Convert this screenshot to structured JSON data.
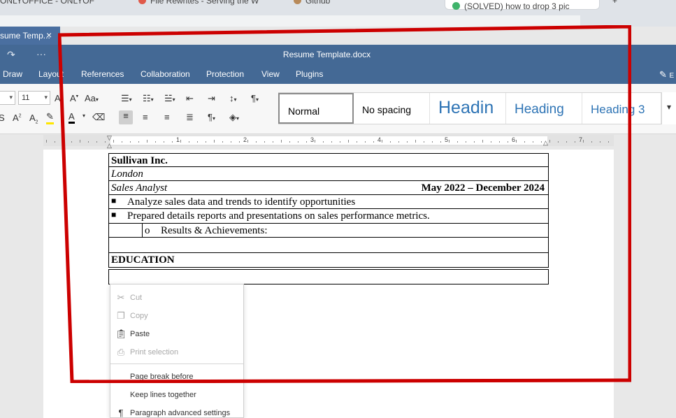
{
  "browser": {
    "tabs": [
      {
        "label": "ONLYOFFICE - ONLYOF",
        "dot": "#e08a33"
      },
      {
        "label": "File Rewrites - Serving the W",
        "dot": "#e05a4a"
      },
      {
        "label": "Github",
        "dot": "#b88a5a"
      },
      {
        "label": "(SOLVED) how to drop 3 pic",
        "dot": "#3fb36b"
      }
    ],
    "new_tab": "+"
  },
  "editor": {
    "doc_tab": "sume Temp...",
    "doc_tab_close": "×",
    "title": "Resume Template.docx",
    "redo_icon": "↷",
    "more_icon": "···",
    "menu": [
      "Draw",
      "Layout",
      "References",
      "Collaboration",
      "Protection",
      "View",
      "Plugins"
    ],
    "edit_label": "E"
  },
  "toolbar": {
    "font_name": "",
    "font_size": "11",
    "styles": [
      "Normal",
      "No spacing",
      "Headin",
      "Heading",
      "Heading 3"
    ],
    "style_colors": {
      "normal": "#000000",
      "heading": "#2e74b5"
    }
  },
  "ruler": {
    "numbers": [
      "1",
      "2",
      "3",
      "4",
      "5",
      "6",
      "7"
    ]
  },
  "document": {
    "company": "Sullivan Inc.",
    "city": "London",
    "role": "Sales Analyst",
    "dates": "May 2022 – December 2024",
    "bullets": [
      "Analyze sales data and trends to identify opportunities",
      "Prepared details reports and presentations on sales performance metrics."
    ],
    "sub_bullet_marker": "o",
    "sub_bullet": "Results & Achievements:",
    "section": "EDUCATION"
  },
  "context_menu": {
    "items": [
      {
        "label": "Cut",
        "icon": "scissors-icon",
        "disabled": true
      },
      {
        "label": "Copy",
        "icon": "copy-icon",
        "disabled": true
      },
      {
        "label": "Paste",
        "icon": "paste-icon",
        "disabled": false
      },
      {
        "label": "Print selection",
        "icon": "print-icon",
        "disabled": true
      },
      {
        "label": "Page break before",
        "icon": "",
        "disabled": false
      },
      {
        "label": "Keep lines together",
        "icon": "",
        "disabled": false
      },
      {
        "label": "Paragraph advanced settings",
        "icon": "paragraph-icon",
        "disabled": false
      }
    ]
  },
  "annotation": {
    "color": "#cc0000"
  }
}
